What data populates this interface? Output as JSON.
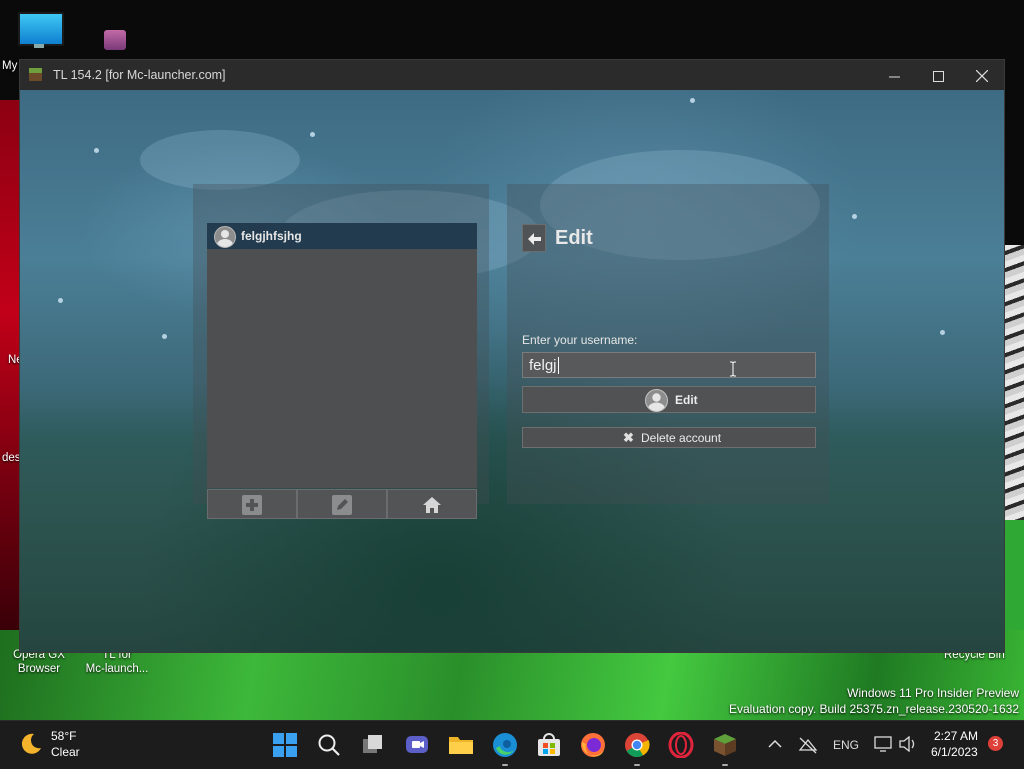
{
  "desktop": {
    "icons": [
      {
        "label_line1": "My",
        "label_line2": ""
      },
      {
        "label_line1": "Ne",
        "label_line2": ""
      },
      {
        "label_line1": "des",
        "label_line2": ""
      },
      {
        "label_line1": "Opera GX",
        "label_line2": "Browser"
      },
      {
        "label_line1": "TL for",
        "label_line2": "Mc-launch..."
      },
      {
        "label_line1": "Recycle Bin",
        "label_line2": ""
      }
    ],
    "watermark": {
      "line1": "Windows 11 Pro Insider Preview",
      "line2": "Evaluation copy. Build 25375.zn_release.230520-1632"
    }
  },
  "window": {
    "title": "TL 154.2 [for Mc-launcher.com]",
    "controls": {
      "minimize": "minimize-icon",
      "maximize": "maximize-icon",
      "close": "close-icon"
    },
    "accounts": [
      {
        "name": "felgjhfsjhg",
        "selected": true
      }
    ],
    "list_toolbar": [
      {
        "icon": "plus-icon",
        "action": "add"
      },
      {
        "icon": "pencil-icon",
        "action": "edit"
      },
      {
        "icon": "home-icon",
        "action": "home"
      }
    ],
    "edit_panel": {
      "title": "Edit",
      "back_icon": "arrow-left-icon",
      "username_label": "Enter your username:",
      "username_value": "felgj",
      "edit_button": "Edit",
      "delete_button": "Delete account"
    }
  },
  "taskbar": {
    "weather": {
      "temp": "58°F",
      "desc": "Clear",
      "icon": "moon-icon"
    },
    "apps": [
      "windows-start-icon",
      "search-icon",
      "task-view-icon",
      "teams-chat-icon",
      "file-explorer-icon",
      "edge-icon",
      "microsoft-store-icon",
      "firefox-icon",
      "chrome-icon",
      "opera-gx-icon",
      "tl-launcher-icon"
    ],
    "tray": {
      "language": "ENG"
    },
    "clock": {
      "time": "2:27 AM",
      "date": "6/1/2023"
    },
    "notifications": "3"
  },
  "colors": {
    "selected_row": "#223b4e",
    "panel_bg": "#4d4f51",
    "taskbar_bg": "#1c1c1c",
    "notification_badge": "#e0403a"
  }
}
